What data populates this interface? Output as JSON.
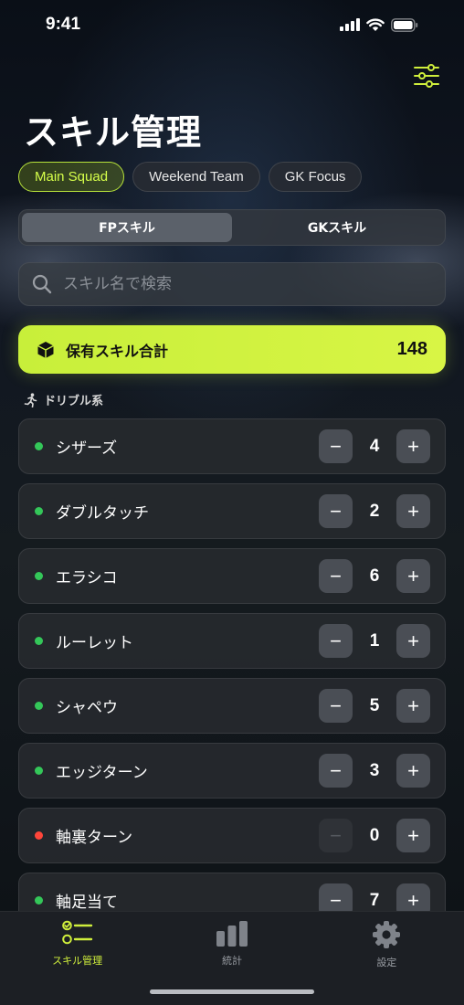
{
  "status_bar": {
    "time": "9:41"
  },
  "header": {
    "title": "スキル管理"
  },
  "teams": [
    {
      "label": "Main Squad",
      "active": true
    },
    {
      "label": "Weekend Team",
      "active": false
    },
    {
      "label": "GK Focus",
      "active": false
    }
  ],
  "segments": [
    {
      "label": "FPスキル",
      "active": true
    },
    {
      "label": "GKスキル",
      "active": false
    }
  ],
  "search": {
    "placeholder": "スキル名で検索",
    "value": ""
  },
  "total": {
    "label": "保有スキル合計",
    "value": "148"
  },
  "section": {
    "title": "ドリブル系"
  },
  "skills": [
    {
      "name": "シザーズ",
      "count": "4",
      "status_color": "#34c759"
    },
    {
      "name": "ダブルタッチ",
      "count": "2",
      "status_color": "#34c759"
    },
    {
      "name": "エラシコ",
      "count": "6",
      "status_color": "#34c759"
    },
    {
      "name": "ルーレット",
      "count": "1",
      "status_color": "#34c759"
    },
    {
      "name": "シャペウ",
      "count": "5",
      "status_color": "#34c759"
    },
    {
      "name": "エッジターン",
      "count": "3",
      "status_color": "#34c759"
    },
    {
      "name": "軸裏ターン",
      "count": "0",
      "status_color": "#ff453a"
    },
    {
      "name": "軸足当て",
      "count": "7",
      "status_color": "#34c759"
    }
  ],
  "stepper": {
    "minus": "−",
    "plus": "+"
  },
  "tab_bar": [
    {
      "label": "スキル管理",
      "icon": "checklist-icon",
      "active": true
    },
    {
      "label": "統計",
      "icon": "bar-chart-icon",
      "active": false
    },
    {
      "label": "設定",
      "icon": "gear-icon",
      "active": false
    }
  ],
  "colors": {
    "accent": "#cfee3c",
    "active_dot": "#34c759",
    "zero_dot": "#ff453a"
  }
}
